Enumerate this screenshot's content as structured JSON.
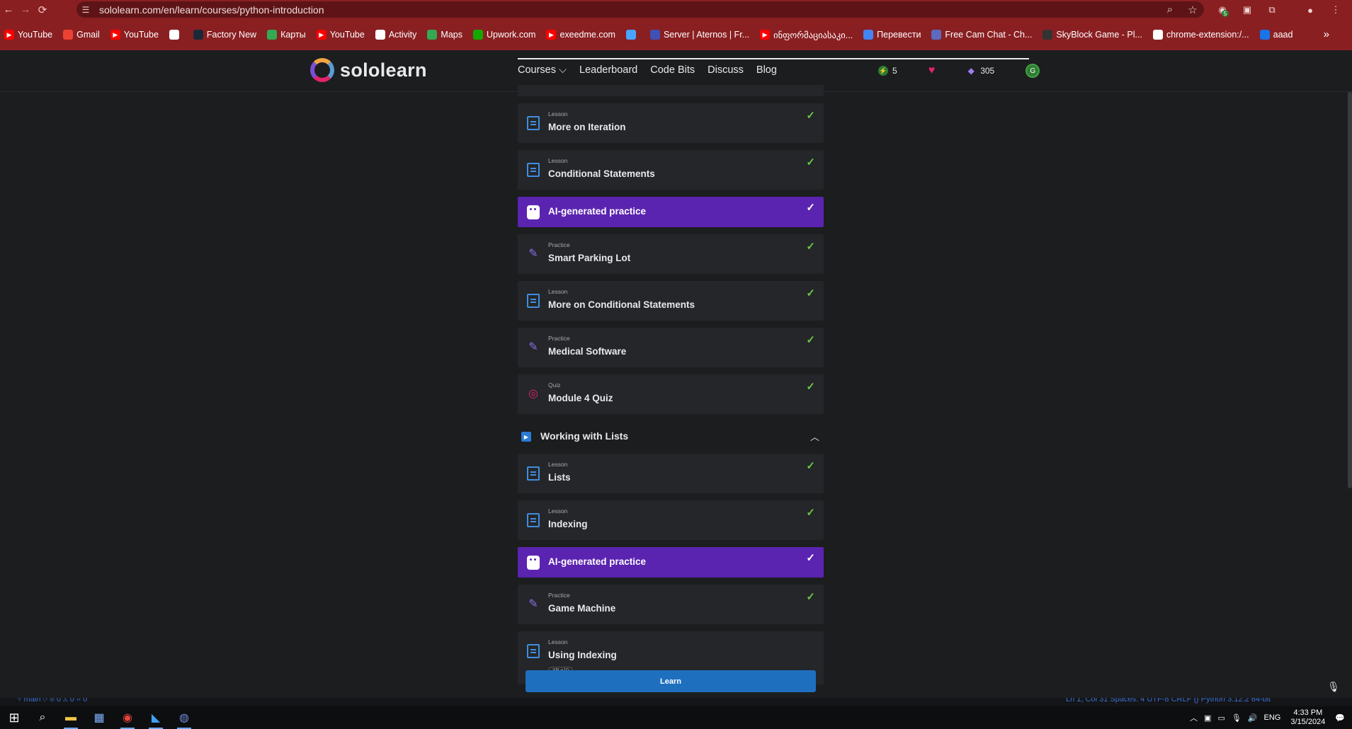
{
  "browser": {
    "url": "sololearn.com/en/learn/courses/python-introduction",
    "bookmarks": [
      {
        "label": "YouTube",
        "icon": "youtube-icon",
        "color": "#ff0000"
      },
      {
        "label": "Gmail",
        "icon": "gmail-icon",
        "color": "#ea4335"
      },
      {
        "label": "YouTube",
        "icon": "youtube-icon",
        "color": "#ff0000"
      },
      {
        "label": "",
        "icon": "globe-icon",
        "color": "#ffffff"
      },
      {
        "label": "Factory New",
        "icon": "steam-icon",
        "color": "#1b2838"
      },
      {
        "label": "Карты",
        "icon": "maps-pin-icon",
        "color": "#34a853"
      },
      {
        "label": "YouTube",
        "icon": "youtube-icon",
        "color": "#ff0000"
      },
      {
        "label": "Activity",
        "icon": "globe-icon",
        "color": "#ffffff"
      },
      {
        "label": "Maps",
        "icon": "maps-pin-icon",
        "color": "#34a853"
      },
      {
        "label": "Upwork.com",
        "icon": "upwork-icon",
        "color": "#14a800"
      },
      {
        "label": "exeedme.com",
        "icon": "youtube-icon",
        "color": "#ff0000"
      },
      {
        "label": "",
        "icon": "refresh-icon",
        "color": "#4aa3ff"
      },
      {
        "label": "Server | Aternos | Fr...",
        "icon": "aternos-icon",
        "color": "#3f51b5"
      },
      {
        "label": "ინფორმაციასაკი...",
        "icon": "youtube-icon",
        "color": "#ff0000"
      },
      {
        "label": "Перевести",
        "icon": "translate-icon",
        "color": "#4285f4"
      },
      {
        "label": "Free Cam Chat - Ch...",
        "icon": "chat-icon",
        "color": "#5c6bc0"
      },
      {
        "label": "SkyBlock Game - Pl...",
        "icon": "vs-icon",
        "color": "#333333"
      },
      {
        "label": "chrome-extension:/...",
        "icon": "globe-icon",
        "color": "#ffffff"
      },
      {
        "label": "aaad",
        "icon": "account-icon",
        "color": "#1a73e8"
      }
    ],
    "extension_badge": "5"
  },
  "header": {
    "brand": "sololearn",
    "nav": [
      "Courses ⌵",
      "Leaderboard",
      "Code Bits",
      "Discuss",
      "Blog"
    ],
    "streak": "5",
    "gems": "305",
    "avatar_letter": "G"
  },
  "module_a_items": [
    {
      "kind": "Lesson",
      "title": "More on Iteration",
      "type": "lesson",
      "done": true
    },
    {
      "kind": "Lesson",
      "title": "Conditional Statements",
      "type": "lesson",
      "done": true
    },
    {
      "kind": "",
      "title": "AI-generated practice",
      "type": "ai",
      "done": true
    },
    {
      "kind": "Practice",
      "title": "Smart Parking Lot",
      "type": "practice",
      "done": true
    },
    {
      "kind": "Lesson",
      "title": "More on Conditional Statements",
      "type": "lesson",
      "done": true
    },
    {
      "kind": "Practice",
      "title": "Medical Software",
      "type": "practice",
      "done": true
    },
    {
      "kind": "Quiz",
      "title": "Module 4 Quiz",
      "type": "quiz",
      "done": true
    }
  ],
  "module_b": {
    "title": "Working with Lists",
    "items": [
      {
        "kind": "Lesson",
        "title": "Lists",
        "type": "lesson",
        "done": true
      },
      {
        "kind": "Lesson",
        "title": "Indexing",
        "type": "lesson",
        "done": true
      },
      {
        "kind": "",
        "title": "AI-generated practice",
        "type": "ai",
        "done": true
      },
      {
        "kind": "Practice",
        "title": "Game Machine",
        "type": "practice",
        "done": true
      }
    ],
    "current": {
      "kind": "Lesson",
      "title": "Using Indexing",
      "xp": "XP +10",
      "button": "Learn"
    }
  },
  "vscode_status": {
    "left": "⑂ main  ⟳  ⊗ 0 ⚠ 0   ⌗ 0",
    "right": "Ln 1, Col 31   Spaces: 4   UTF-8   CRLF   {} Python   3.12.2 64-bit"
  },
  "taskbar": {
    "lang": "ENG",
    "time": "4:33 PM",
    "date": "3/15/2024"
  }
}
